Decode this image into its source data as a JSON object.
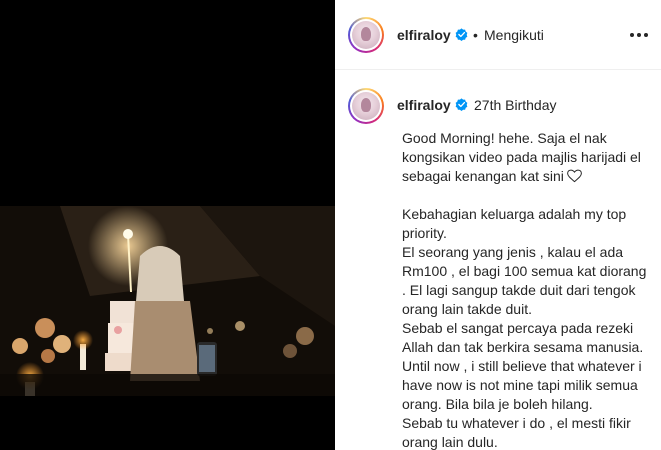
{
  "post": {
    "username": "elfiraloy",
    "follow_status": "Mengikuti",
    "separator": "•",
    "caption_title": "27th Birthday",
    "caption_lines": [
      "Good Morning! hehe. Saja el nak kongsikan video pada majlis harijadi el sebagai kenangan kat sini",
      "",
      "Kebahagian keluarga adalah my top priority.",
      "El seorang yang jenis , kalau el ada Rm100 , el bagi 100 semua kat diorang . El lagi sangup takde duit dari tengok orang lain takde duit.",
      "Sebab el sangat percaya pada rezeki Allah dan tak berkira sesama manusia.",
      "Until now , i still believe that whatever i have now is not mine tapi milik semua orang. Bila bila je boleh hilang.",
      "Sebab tu whatever i do , el mesti fikir orang lain dulu."
    ]
  },
  "icons": {
    "verified": "verified-badge-icon",
    "more": "more-options-icon",
    "heart": "heart-icon"
  },
  "colors": {
    "verified_blue": "#0095f6",
    "text": "#262626"
  }
}
